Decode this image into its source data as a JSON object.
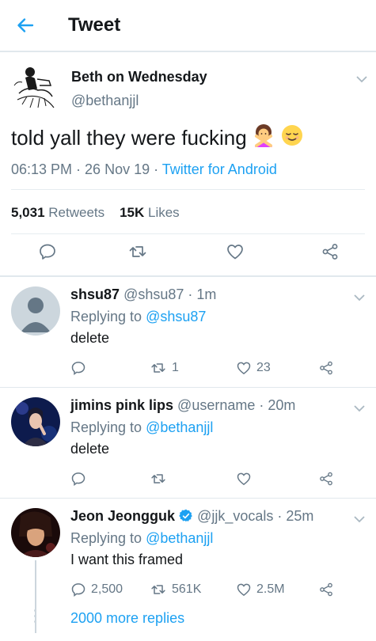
{
  "header": {
    "title": "Tweet",
    "back_icon": "arrow-left-icon"
  },
  "main_tweet": {
    "author_name": "Beth on Wednesday",
    "author_handle": "@bethanjjl",
    "text": "told yall they were fucking",
    "emojis": [
      "person-gesturing-no-emoji",
      "relieved-face-emoji"
    ],
    "time": "06:13 PM",
    "date": "26 Nov 19",
    "source": "Twitter for Android",
    "retweets_count": "5,031",
    "retweets_label": "Retweets",
    "likes_count": "15K",
    "likes_label": "Likes"
  },
  "replies": [
    {
      "name": "shsu87",
      "handle": "@shsu87",
      "time": "1m",
      "replying_label": "Replying to",
      "replying_to": "@shsu87",
      "text": "delete",
      "reply_count": "",
      "retweet_count": "1",
      "like_count": "23"
    },
    {
      "name": "jimins pink lips",
      "handle": "@username",
      "time": "20m",
      "replying_label": "Replying to",
      "replying_to": "@bethanjjl",
      "text": "delete",
      "reply_count": "",
      "retweet_count": "",
      "like_count": ""
    },
    {
      "name": "Jeon Jeongguk",
      "handle": "@jjk_vocals",
      "time": "25m",
      "replying_label": "Replying to",
      "replying_to": "@bethanjjl",
      "text": "I want this framed",
      "reply_count": "2,500",
      "retweet_count": "561K",
      "like_count": "2.5M",
      "verified": true,
      "more_replies": "2000 more replies"
    }
  ],
  "colors": {
    "accent": "#1da1f2",
    "secondary_text": "#657786",
    "border": "#e1e8ed",
    "verified": "#1da1f2"
  }
}
